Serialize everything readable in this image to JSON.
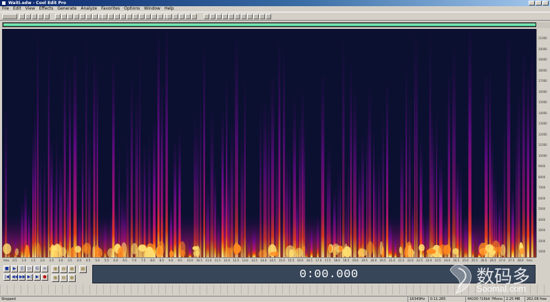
{
  "window": {
    "title": "Waiti.edw - Cool Edit Pro"
  },
  "menu": [
    "File",
    "Edit",
    "View",
    "Effects",
    "Generate",
    "Analyze",
    "Favorites",
    "Options",
    "Window",
    "Help"
  ],
  "frequency_ticks": [
    "21000",
    "20000",
    "19000",
    "18000",
    "17000",
    "16000",
    "15000",
    "14000",
    "13000",
    "12000",
    "11000",
    "10000",
    "9000",
    "8000",
    "7000",
    "6000",
    "5000",
    "4000",
    "3000",
    "2000",
    "1000"
  ],
  "time_ticks": [
    "hms",
    "0.5",
    "1.0",
    "1.5",
    "2.0",
    "2.5",
    "3.0",
    "3.5",
    "4.0",
    "4.5",
    "5.0",
    "5.5",
    "6.0",
    "6.5",
    "7.0",
    "7.5",
    "8.0",
    "8.5",
    "9.0",
    "9.5",
    "10.0",
    "10.5",
    "11.0",
    "11.5",
    "12.0",
    "12.5",
    "13.0",
    "13.5",
    "14.0",
    "14.5",
    "15.0",
    "15.5",
    "16.0",
    "16.5",
    "17.0",
    "17.5",
    "18.0",
    "18.5",
    "19.0",
    "19.5",
    "20.0",
    "20.5",
    "21.0",
    "21.5",
    "22.0",
    "22.5",
    "23.0",
    "23.5",
    "24.0",
    "24.5",
    "25.0",
    "25.5",
    "26.0",
    "26.5",
    "27.0",
    "27.5",
    "28.0",
    "hms"
  ],
  "transport": {
    "row1": [
      "■",
      "▶",
      "||",
      "▷",
      "G",
      "∞"
    ],
    "row2": [
      "|◀",
      "◀◀",
      "▶▶",
      "▶|",
      "▶",
      "●"
    ]
  },
  "zoom": {
    "row1": [
      "⊕",
      "⊖",
      "⊕",
      "⊞"
    ],
    "row2": [
      "⊕",
      "⊖",
      "⊕"
    ]
  },
  "time_display": "0:00.000",
  "status": {
    "state": "Stopped",
    "sample_rate_info": "16349Hz 8",
    "position": "0:11.265",
    "format": "44100 ?16bit ?Mono",
    "size": "2.25 MB",
    "free": "262.08 free"
  },
  "watermark": {
    "cn": "数码多",
    "en": "Soomal.com"
  }
}
